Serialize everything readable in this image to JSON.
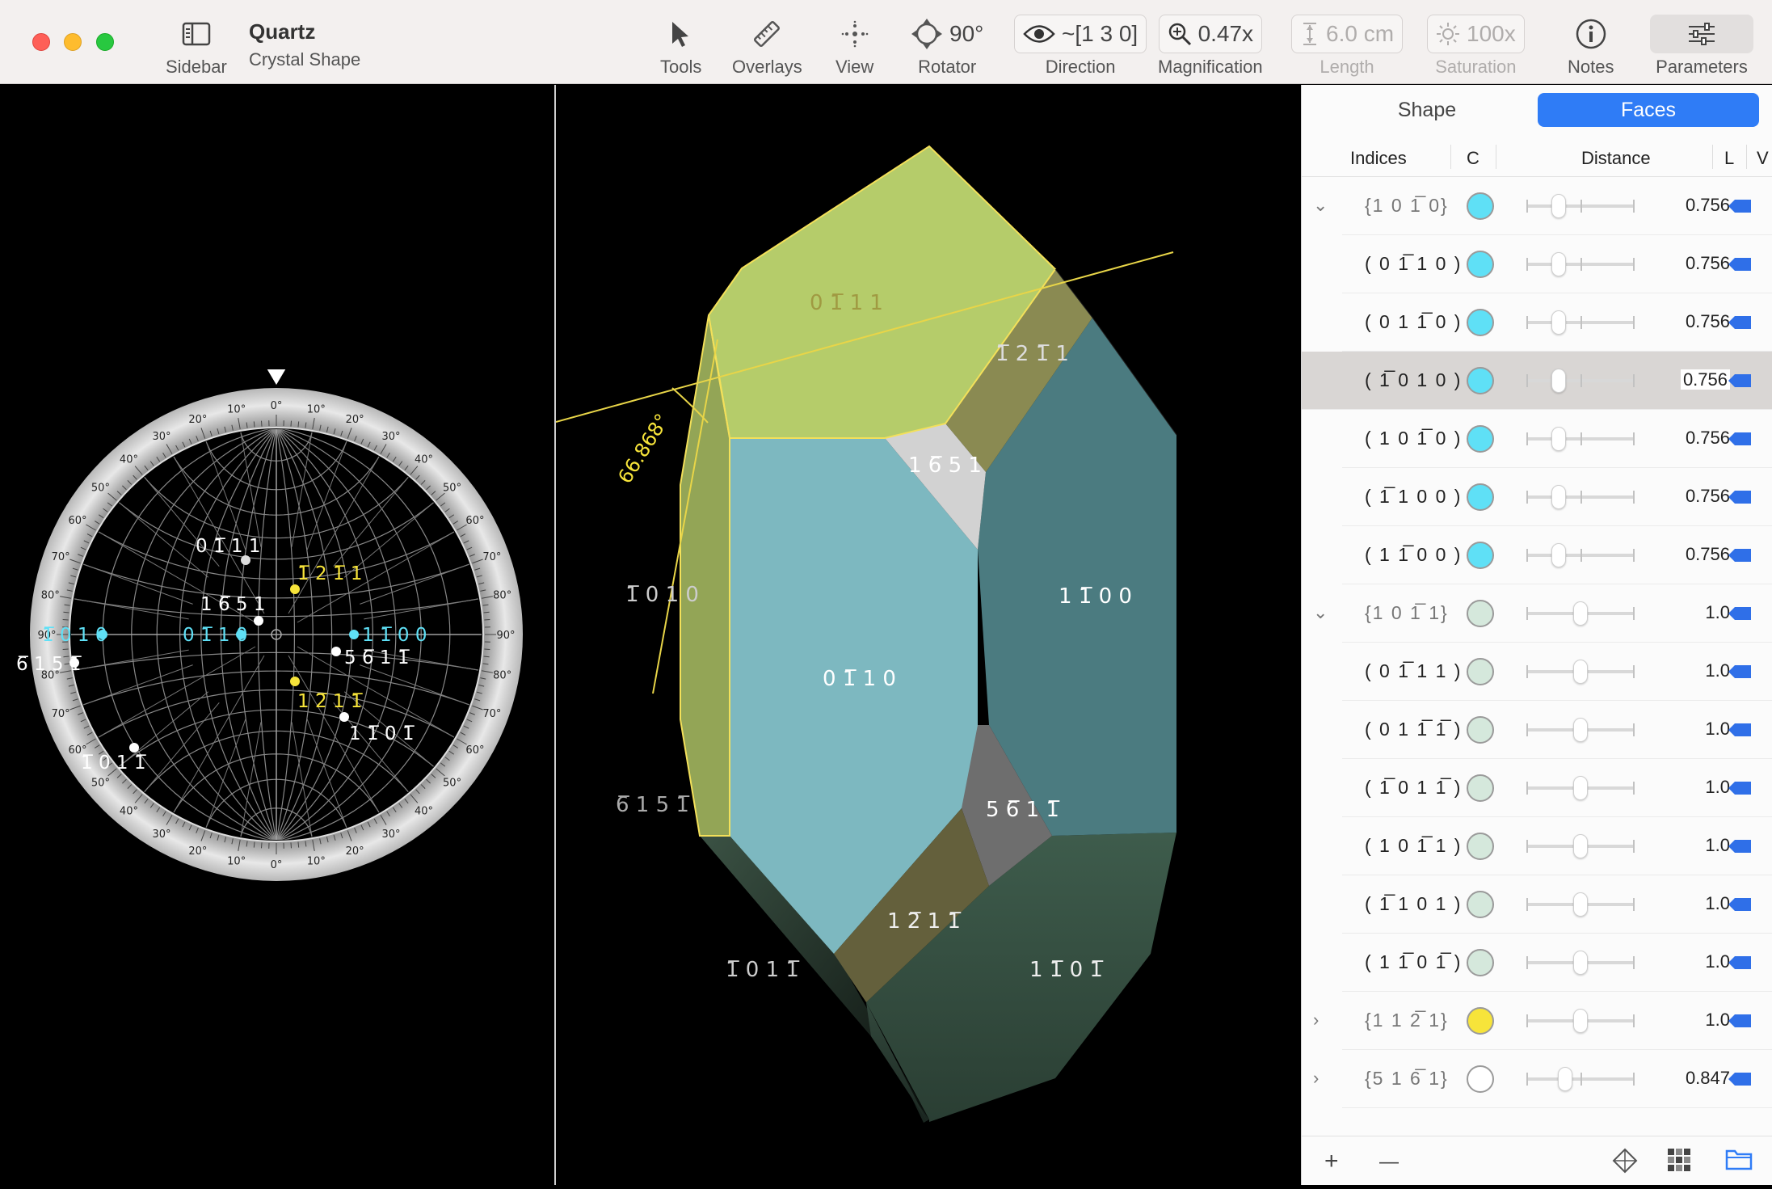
{
  "app": {
    "title": "Quartz",
    "subtitle": "Crystal Shape"
  },
  "toolbar": {
    "sidebar_label": "Sidebar",
    "tools_label": "Tools",
    "overlays_label": "Overlays",
    "view_label": "View",
    "rotator_label": "Rotator",
    "rotator_value": "90°",
    "direction_label": "Direction",
    "direction_value": "~[1 3 0]",
    "magnification_label": "Magnification",
    "magnification_value": "0.47x",
    "length_label": "Length",
    "length_value": "6.0 cm",
    "saturation_label": "Saturation",
    "saturation_value": "100x",
    "notes_label": "Notes",
    "parameters_label": "Parameters"
  },
  "sidebar": {
    "tabs": [
      {
        "label": "Shape",
        "active": false
      },
      {
        "label": "Faces",
        "active": true
      }
    ],
    "headers": {
      "indices": "Indices",
      "c": "C",
      "distance": "Distance",
      "l": "L",
      "v": "V"
    },
    "rows": [
      {
        "indices": "{1 0 1̅ 0}",
        "family": true,
        "chevron": "⌄",
        "color": "#5fe0f6",
        "distance": "0.756",
        "slider": 0.3,
        "selected": false
      },
      {
        "indices": "( 0 1̅ 1 0 )",
        "family": false,
        "color": "#5fe0f6",
        "distance": "0.756",
        "slider": 0.3,
        "selected": false
      },
      {
        "indices": "( 0 1 1̅ 0 )",
        "family": false,
        "color": "#5fe0f6",
        "distance": "0.756",
        "slider": 0.3,
        "selected": false
      },
      {
        "indices": "( 1̅ 0 1 0 )",
        "family": false,
        "color": "#5fe0f6",
        "distance": "0.756",
        "slider": 0.3,
        "selected": true
      },
      {
        "indices": "( 1 0 1̅ 0 )",
        "family": false,
        "color": "#5fe0f6",
        "distance": "0.756",
        "slider": 0.3,
        "selected": false
      },
      {
        "indices": "( 1̅ 1 0 0 )",
        "family": false,
        "color": "#5fe0f6",
        "distance": "0.756",
        "slider": 0.3,
        "selected": false
      },
      {
        "indices": "( 1 1̅ 0 0 )",
        "family": false,
        "color": "#5fe0f6",
        "distance": "0.756",
        "slider": 0.3,
        "selected": false
      },
      {
        "indices": "{1 0 1̅ 1}",
        "family": true,
        "chevron": "⌄",
        "color": "#d5e8dc",
        "distance": "1.0",
        "slider": 0.5,
        "selected": false
      },
      {
        "indices": "( 0 1̅ 1 1 )",
        "family": false,
        "color": "#d5e8dc",
        "distance": "1.0",
        "slider": 0.5,
        "selected": false
      },
      {
        "indices": "( 0 1 1̅ 1̅ )",
        "family": false,
        "color": "#d5e8dc",
        "distance": "1.0",
        "slider": 0.5,
        "selected": false
      },
      {
        "indices": "( 1̅ 0 1 1̅ )",
        "family": false,
        "color": "#d5e8dc",
        "distance": "1.0",
        "slider": 0.5,
        "selected": false
      },
      {
        "indices": "( 1 0 1̅ 1 )",
        "family": false,
        "color": "#d5e8dc",
        "distance": "1.0",
        "slider": 0.5,
        "selected": false
      },
      {
        "indices": "( 1̅ 1 0 1 )",
        "family": false,
        "color": "#d5e8dc",
        "distance": "1.0",
        "slider": 0.5,
        "selected": false
      },
      {
        "indices": "( 1 1̅ 0 1̅ )",
        "family": false,
        "color": "#d5e8dc",
        "distance": "1.0",
        "slider": 0.5,
        "selected": false
      },
      {
        "indices": "{1 1 2̅ 1}",
        "family": true,
        "chevron": "›",
        "color": "#f7e43a",
        "distance": "1.0",
        "slider": 0.5,
        "selected": false
      },
      {
        "indices": "{5 1 6̅ 1}",
        "family": true,
        "chevron": "›",
        "color": "#ffffff",
        "distance": "0.847",
        "slider": 0.36,
        "selected": false
      }
    ],
    "footer": {
      "add": "+",
      "remove": "—"
    }
  },
  "stereonet": {
    "top_marker": "0°",
    "labels": [
      {
        "text": "0 1̅ 1 1",
        "color": "#ffffff"
      },
      {
        "text": "1̅ 2 1̅ 1",
        "color": "#f7e43a"
      },
      {
        "text": "1 6̅ 5 1",
        "color": "#ffffff"
      },
      {
        "text": "1̅ 0 1 0",
        "color": "#5fe0f6"
      },
      {
        "text": "0 1̅ 1 0",
        "color": "#5fe0f6"
      },
      {
        "text": "1 1̅ 0 0",
        "color": "#5fe0f6"
      },
      {
        "text": "5 6̅ 1 1̅",
        "color": "#ffffff"
      },
      {
        "text": "6̅ 1 5 1̅",
        "color": "#ffffff"
      },
      {
        "text": "1 2̅ 1 1̅",
        "color": "#f7e43a"
      },
      {
        "text": "1 1̅ 0 1̅",
        "color": "#ffffff"
      },
      {
        "text": "1̅ 0 1 1̅",
        "color": "#ffffff"
      }
    ]
  },
  "crystal": {
    "angle_label": "66.868°",
    "faces": [
      {
        "text": "0 1̅ 1 1"
      },
      {
        "text": "1̅ 2 1̅ 1"
      },
      {
        "text": "1 6̅ 5 1"
      },
      {
        "text": "1̅ 0 1 0"
      },
      {
        "text": "0 1̅ 1 0"
      },
      {
        "text": "1 1̅ 0 0"
      },
      {
        "text": "5 6̅ 1 1̅"
      },
      {
        "text": "6̅ 1 5 1̅"
      },
      {
        "text": "1 2̅ 1 1̅"
      },
      {
        "text": "1̅ 0 1 1̅"
      },
      {
        "text": "1 1̅ 0 1̅"
      }
    ]
  }
}
